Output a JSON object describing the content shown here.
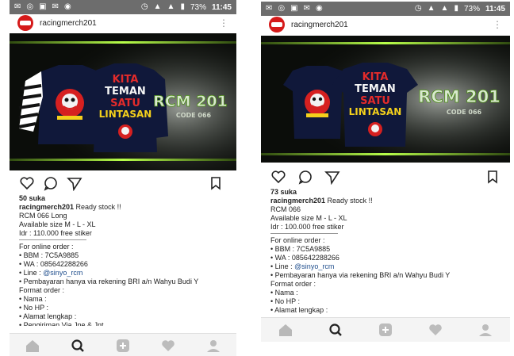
{
  "statusbar": {
    "time": "11:45",
    "battery": "73%"
  },
  "posts": [
    {
      "username": "racingmerch201",
      "likes": "50 suka",
      "caption_user": "racingmerch201",
      "caption_text": " Ready stock !!",
      "lines": [
        "RCM 066 Long",
        "Available size M - L - XL",
        "Idr : 110.000 free stiker"
      ],
      "order_header": "For online order :",
      "bbm": "• BBM :  7C5A9885",
      "wa": "• WA : 085642288266",
      "line_prefix": "• Line : ",
      "line_handle": "@sinyo_rcm",
      "payment": "•  Pembayaran hanya via rekening BRI a/n Wahyu Budi Y",
      "format": "Format order :",
      "nama": "• Nama :",
      "nohp": "• No HP :",
      "alamat": "• Alamat lengkap :",
      "cut": "• Pengiriman Via Jne & Jnt"
    },
    {
      "username": "racingmerch201",
      "likes": "73 suka",
      "caption_user": "racingmerch201",
      "caption_text": " Ready stock !!",
      "lines": [
        "RCM 066",
        "Available size M - L - XL",
        "Idr : 100.000 free stiker"
      ],
      "order_header": "For online order :",
      "bbm": "• BBM :  7C5A9885",
      "wa": "• WA : 085642288266",
      "line_prefix": "• Line : ",
      "line_handle": "@sinyo_rcm",
      "payment": "•  Pembayaran hanya via rekening BRI a/n Wahyu Budi Y",
      "format": "Format order :",
      "nama": "• Nama :",
      "nohp": "• No HP :",
      "alamat": "• Alamat lengkap :"
    }
  ],
  "artwork": {
    "shirt_text_1": "KITA",
    "shirt_text_2": "TEMAN",
    "shirt_text_3": "SATU",
    "shirt_text_4": "LINTASAN",
    "brand": "RCM 201",
    "code": "CODE 066"
  },
  "nav_icons": [
    "home-icon",
    "search-icon",
    "add-post-icon",
    "heart-icon",
    "profile-icon"
  ],
  "colors": {
    "statusbar": "#6d6d6d",
    "link": "#1e4d8c",
    "avatar": "#d51a1a",
    "accent_green": "#9be23a"
  }
}
